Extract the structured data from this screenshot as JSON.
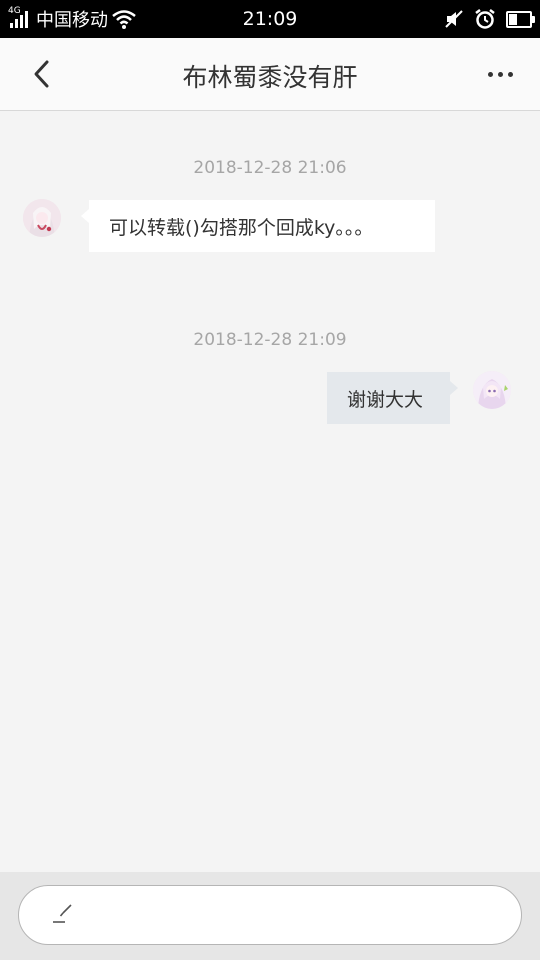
{
  "status_bar": {
    "signal_label": "4G",
    "carrier": "中国移动",
    "time": "21:09",
    "battery_level": 0.35,
    "icons": [
      "signal-icon",
      "wifi-icon",
      "mute-icon",
      "alarm-icon",
      "battery-icon"
    ]
  },
  "nav": {
    "title": "布林蜀黍没有肝",
    "back_icon": "back-arrow-icon",
    "more_icon": "more-dots-icon"
  },
  "messages": [
    {
      "timestamp": "2018-12-28 21:06",
      "direction": "incoming",
      "text": "可以转载()勾搭那个回成ky。。。"
    },
    {
      "timestamp": "2018-12-28 21:09",
      "direction": "outgoing",
      "text": "谢谢大大"
    }
  ],
  "input": {
    "value": "",
    "placeholder": "",
    "icon": "pen-icon"
  },
  "colors": {
    "background": "#f4f4f4",
    "incoming_bubble": "#ffffff",
    "outgoing_bubble": "#e4e8ec",
    "timestamp_text": "#a6a6a6"
  }
}
